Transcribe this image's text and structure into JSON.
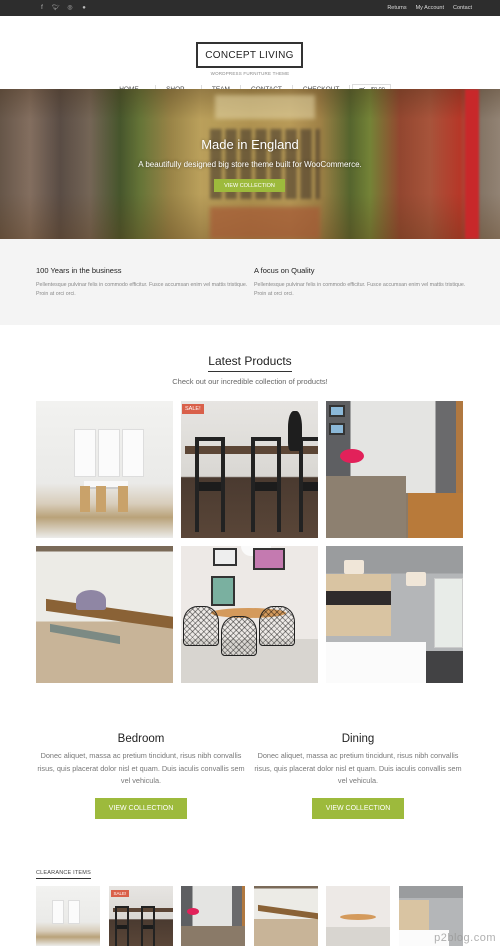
{
  "topbar": {
    "social_icons": [
      {
        "name": "facebook-icon",
        "glyph": "f"
      },
      {
        "name": "twitter-icon",
        "glyph": "t"
      },
      {
        "name": "dribbble-icon",
        "glyph": "◎"
      },
      {
        "name": "github-icon",
        "glyph": "●"
      }
    ],
    "links": [
      "Returns",
      "My Account",
      "Contact"
    ]
  },
  "header": {
    "logo": "CONCEPT LIVING",
    "tagline": "WORDPRESS FURNITURE THEME",
    "nav": [
      {
        "label": "HOME",
        "has_dropdown": true
      },
      {
        "label": "SHOP",
        "has_dropdown": true
      },
      {
        "label": "TEAM",
        "has_dropdown": false
      },
      {
        "label": "CONTACT",
        "has_dropdown": false
      },
      {
        "label": "CHECKOUT",
        "has_dropdown": false
      }
    ],
    "cart_icon": "cart-icon",
    "cart_total": "$0.00"
  },
  "hero": {
    "title": "Made in England",
    "subtitle": "A beautifully designed big store theme built for WooCommerce.",
    "button": "VIEW COLLECTION"
  },
  "features": [
    {
      "title": "100 Years in the business",
      "text": "Pellentesque pulvinar felis in commodo efficitur. Fusce accumsan enim vel mattis tristique. Proin at orci orci."
    },
    {
      "title": "A focus on Quality",
      "text": "Pellentesque pulvinar felis in commodo efficitur. Fusce accumsan enim vel mattis tristique. Proin at orci orci."
    }
  ],
  "latest": {
    "title": "Latest Products",
    "subtitle": "Check out our incredible collection of products!",
    "products": [
      {
        "image": "white dining room with bay window",
        "badge": ""
      },
      {
        "image": "dark dining table with black chairs",
        "badge": "SALE!"
      },
      {
        "image": "rustic wooden table with pink flowers",
        "badge": ""
      },
      {
        "image": "farmhouse dining table with bench",
        "badge": ""
      },
      {
        "image": "round table with wire chairs",
        "badge": ""
      },
      {
        "image": "modern bedroom with pendant lights",
        "badge": ""
      }
    ]
  },
  "collections": [
    {
      "title": "Bedroom",
      "text": "Donec aliquet, massa ac pretium tincidunt, risus nibh convallis risus, quis placerat dolor nisl et quam. Duis iaculis convallis sem vel vehicula.",
      "button": "VIEW COLLECTION"
    },
    {
      "title": "Dining",
      "text": "Donec aliquet, massa ac pretium tincidunt, risus nibh convallis risus, quis placerat dolor nisl et quam. Duis iaculis convallis sem vel vehicula.",
      "button": "VIEW COLLECTION"
    }
  ],
  "clearance": {
    "title": "CLEARANCE ITEMS",
    "items": [
      {
        "badge": ""
      },
      {
        "badge": "SALE!"
      },
      {
        "badge": ""
      },
      {
        "badge": ""
      },
      {
        "badge": ""
      },
      {
        "badge": ""
      }
    ]
  },
  "watermark": "p2blog.com",
  "colors": {
    "accent_green": "#9dba3c",
    "sale_red": "#d9604a",
    "topbar_bg": "#2d2d2d",
    "feature_bg": "#f4f4f4"
  }
}
